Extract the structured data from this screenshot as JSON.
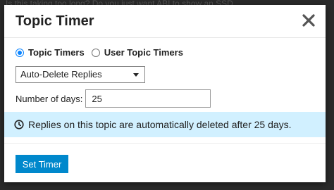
{
  "backdrop": {
    "text": "Is this taking too long? Do you just want ABI to show an SSD..."
  },
  "modal": {
    "title": "Topic Timer",
    "close_icon": "close-icon",
    "radios": [
      {
        "label": "Topic Timers",
        "checked": true
      },
      {
        "label": "User Topic Timers",
        "checked": false
      }
    ],
    "timer_type": {
      "selected": "Auto-Delete Replies"
    },
    "days": {
      "label": "Number of days:",
      "value": "25"
    },
    "notice": {
      "icon": "clock-icon",
      "text": "Replies on this topic are automatically deleted after 25 days."
    },
    "submit_label": "Set Timer"
  },
  "colors": {
    "accent": "#0088cc",
    "notice_bg": "#d1f0ff",
    "radio": "#0a84ff"
  }
}
